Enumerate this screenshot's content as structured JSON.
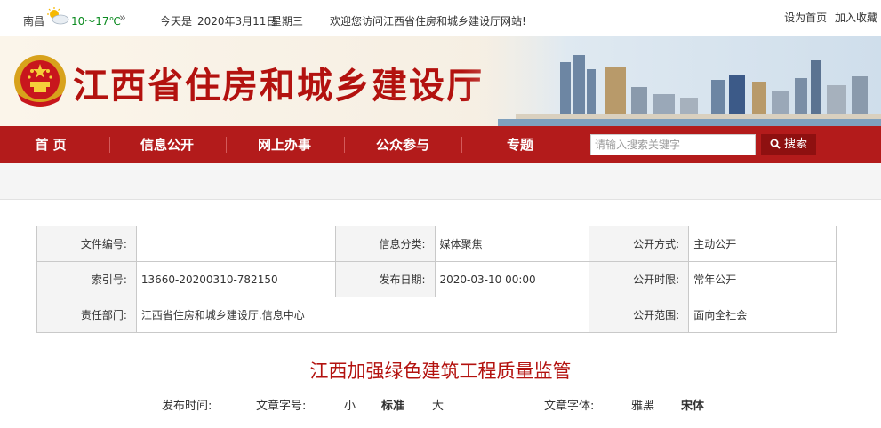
{
  "topbar": {
    "city": "南昌",
    "temperature": "10～17℃",
    "more_arrow": "»",
    "date_label": "今天是",
    "date": "2020年3月11日",
    "weekday": "星期三",
    "welcome": "欢迎您访问江西省住房和城乡建设厅网站!",
    "set_home": "设为首页",
    "add_favorite": "加入收藏",
    "weather_icon": "sun-cloud-icon"
  },
  "banner": {
    "site_title": "江西省住房和城乡建设厅"
  },
  "nav": {
    "items": [
      "首 页",
      "信息公开",
      "网上办事",
      "公众参与",
      "专题"
    ],
    "search_placeholder": "请输入搜索关键字",
    "search_button": "搜索"
  },
  "meta": {
    "rows": [
      [
        {
          "label": "文件编号:",
          "value": ""
        },
        {
          "label": "信息分类:",
          "value": "媒体聚焦"
        },
        {
          "label": "公开方式:",
          "value": "主动公开"
        }
      ],
      [
        {
          "label": "索引号:",
          "value": "13660-20200310-782150"
        },
        {
          "label": "发布日期:",
          "value": "2020-03-10 00:00"
        },
        {
          "label": "公开时限:",
          "value": "常年公开"
        }
      ],
      [
        {
          "label": "责任部门:",
          "value": "江西省住房和城乡建设厅.信息中心"
        },
        {
          "label": "公开范围:",
          "value": "面向全社会"
        }
      ]
    ]
  },
  "article": {
    "title": "江西加强绿色建筑工程质量监管",
    "publish_time_label": "发布时间:",
    "font_size_label": "文章字号:",
    "size_small": "小",
    "size_standard": "标准",
    "size_large": "大",
    "font_face_label": "文章字体:",
    "font_yahei": "雅黑",
    "font_song": "宋体"
  },
  "colors": {
    "brand_red": "#b3120f",
    "nav_red": "#b31b1b",
    "button_dark_red": "#8e1010"
  }
}
